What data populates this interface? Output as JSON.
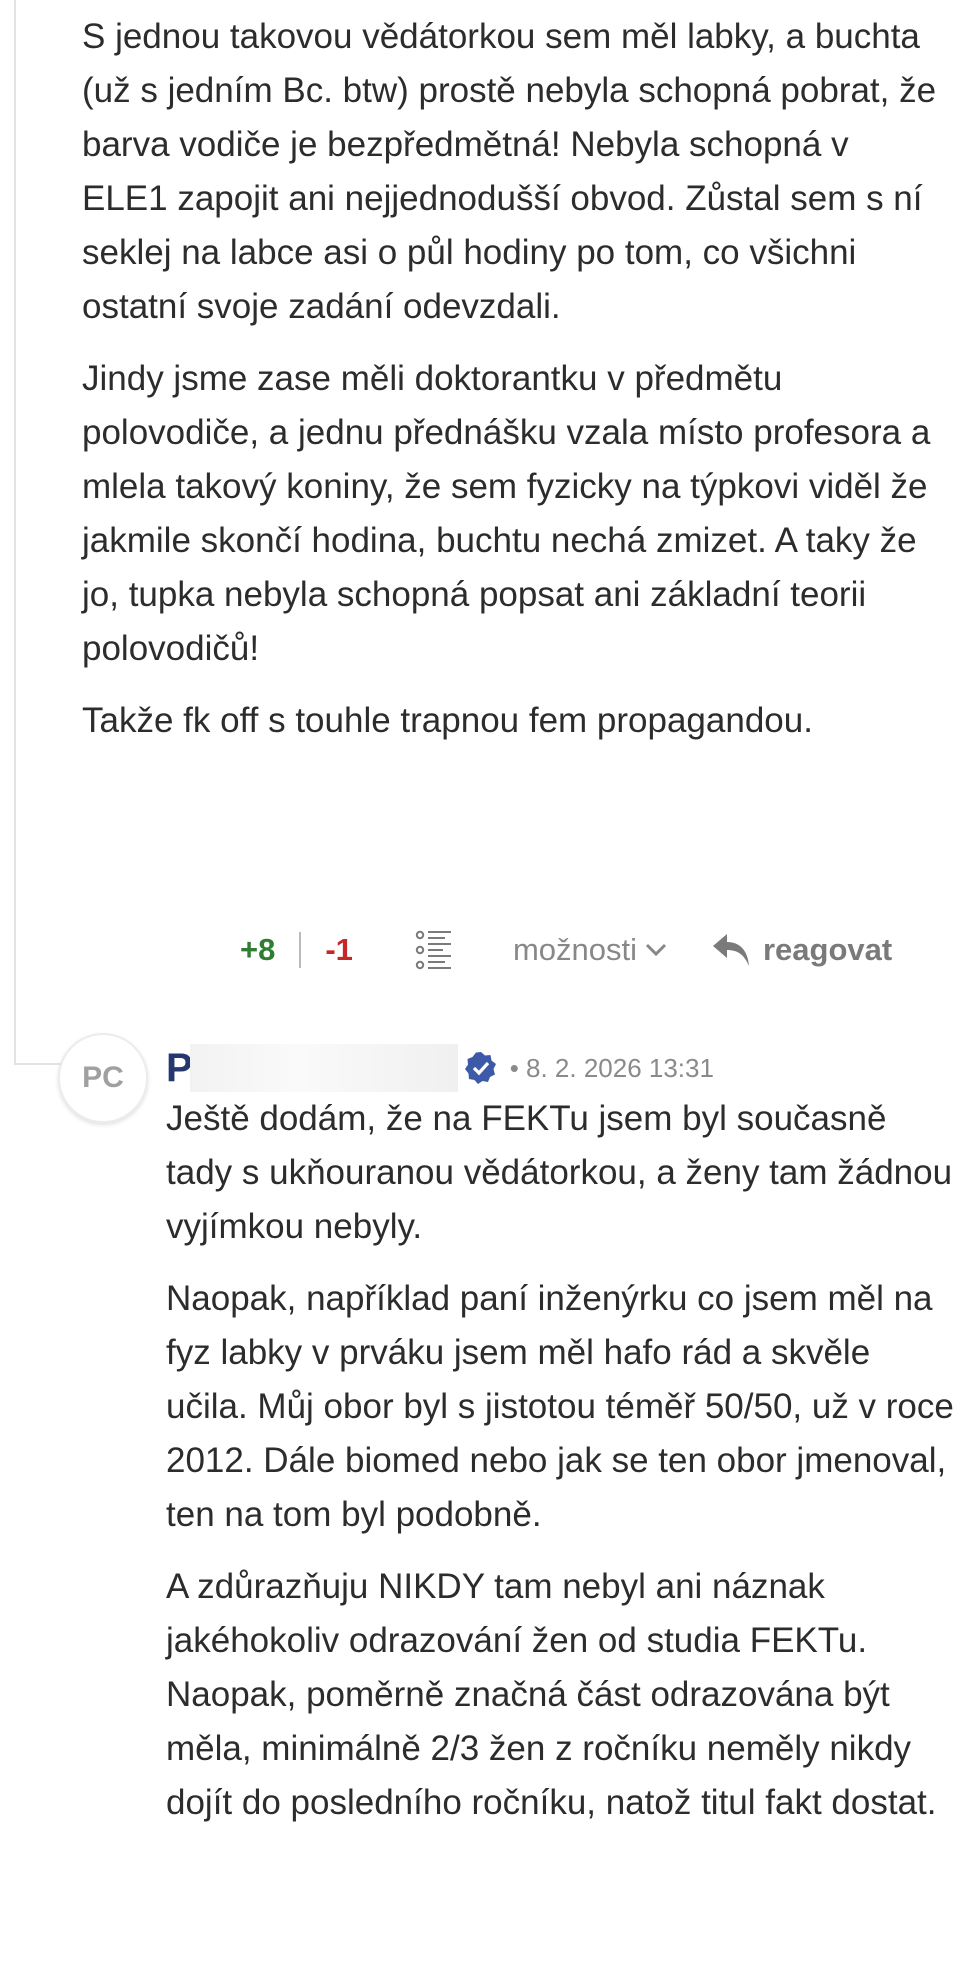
{
  "first_comment": {
    "paragraphs": [
      "S jednou takovou vědátorkou sem měl labky, a buchta (už s jedním Bc. btw) prostě nebyla schopná pobrat, že barva vodiče je bezpředmětná! Nebyla schopná v ELE1 zapojit ani nejjednodušší obvod. Zůstal sem s ní seklej na labce asi o půl hodiny po tom, co všichni ostatní svoje zadání odevzdali.",
      "Jindy jsme zase měli doktorantku v předmětu polovodiče, a jednu přednášku vzala místo profesora a mlela takový koniny, že sem fyzicky na týpkovi viděl že jakmile skončí hodina, buchtu nechá zmizet. A taky že jo, tupka nebyla schopná popsat ani základní teorii polovodičů!",
      "Takže fk off s touhle trapnou fem propagandou."
    ],
    "actions": {
      "upvotes": "+8",
      "downvotes": "-1",
      "outline_icon": "list-outline-icon",
      "options_label": "možnosti",
      "reply_label": "reagovat",
      "reply_icon": "reply-arrow-icon"
    }
  },
  "second_comment": {
    "avatar_initials": "PC",
    "author_visible": "P",
    "verified_icon": "verified-badge-icon",
    "meta": "• 8. 2. 2026 13:31",
    "paragraphs": [
      "Ještě dodám, že na FEKTu jsem byl současně tady s ukňouranou vědátorkou, a ženy tam žádnou vyjímkou nebyly.",
      "Naopak, například paní inženýrku co jsem měl na fyz labky v prváku jsem měl hafo rád a skvěle učila. Můj obor byl s jistotou téměř 50/50, už v roce 2012. Dále biomed nebo jak se ten obor jmenoval, ten na tom byl podobně.",
      "A zdůrazňuju NIKDY tam nebyl ani náznak jakéhokoliv odrazování žen od studia FEKTu. Naopak, poměrně značná část odrazována být měla, minimálně 2/3 žen z ročníku neměly nikdy dojít do posledního ročníku, natož titul fakt dostat."
    ]
  },
  "colors": {
    "author": "#24376f",
    "upvote": "#2f7d32",
    "downvote": "#c62828",
    "verified": "#3d5aa8"
  }
}
